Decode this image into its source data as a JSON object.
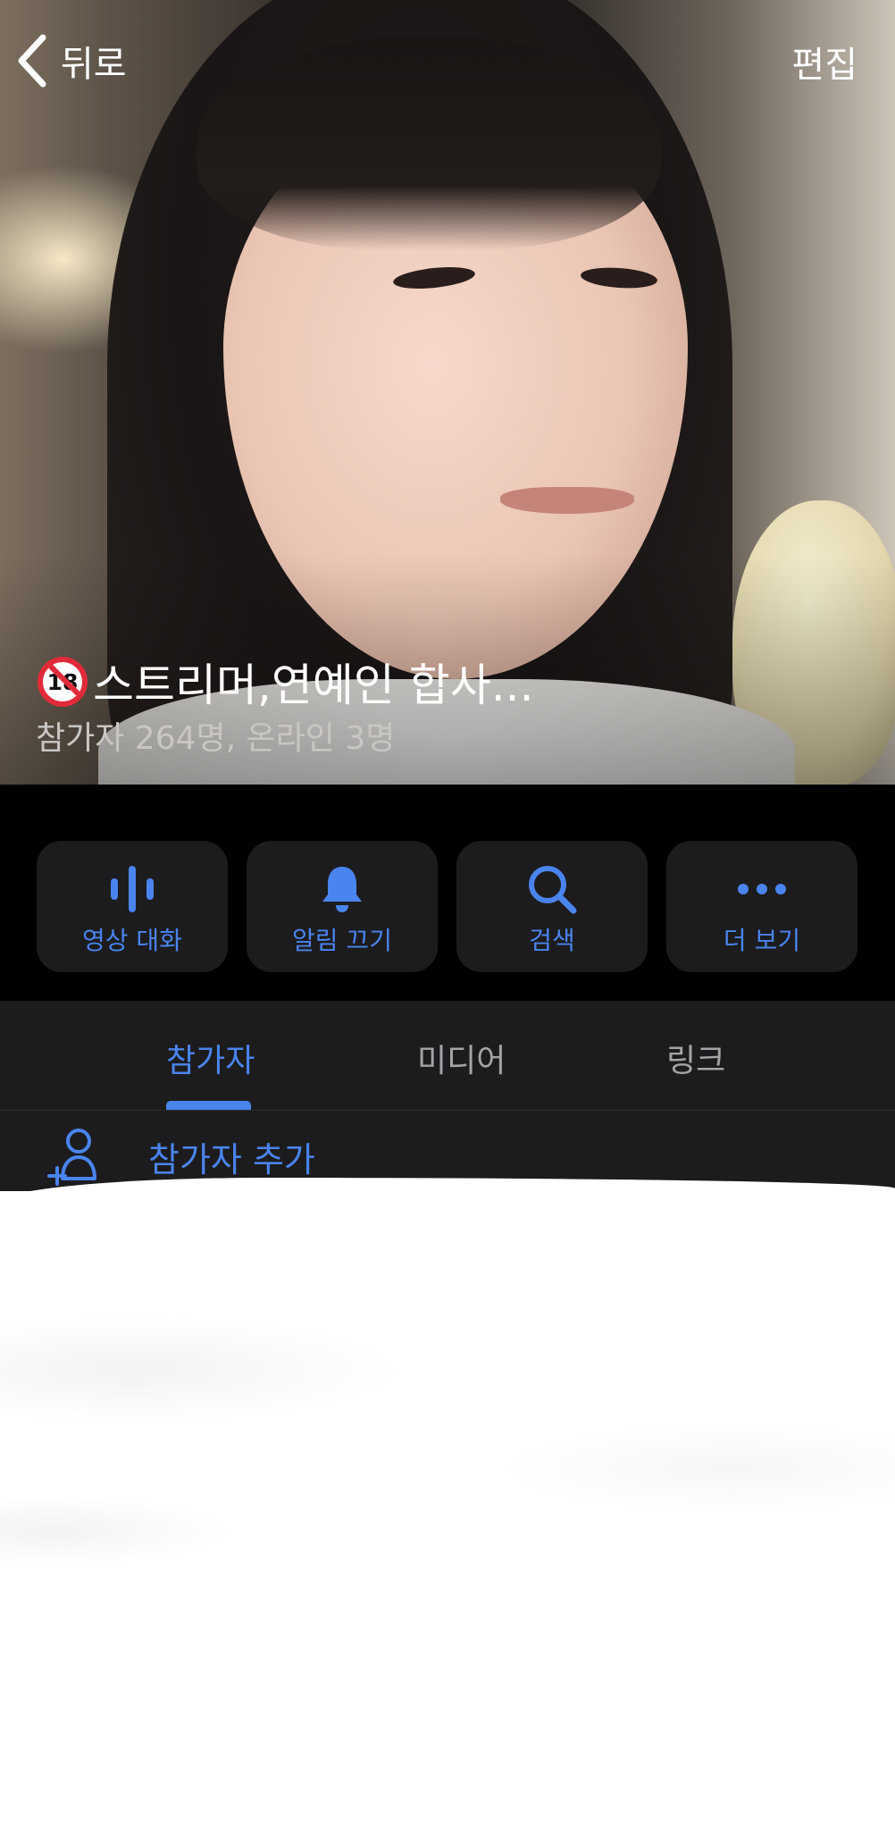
{
  "nav": {
    "back_label": "뒤로",
    "edit_label": "편집"
  },
  "group": {
    "age_badge": "18",
    "title": "스트리머,연예인 합사...",
    "subtitle": "참가자 264명, 온라인 3명"
  },
  "actions": [
    {
      "label": "영상 대화",
      "icon": "audio-waveform-icon"
    },
    {
      "label": "알림 끄기",
      "icon": "bell-icon"
    },
    {
      "label": "검색",
      "icon": "search-icon"
    },
    {
      "label": "더 보기",
      "icon": "ellipsis-icon"
    }
  ],
  "tabs": [
    {
      "label": "참가자",
      "active": true
    },
    {
      "label": "미디어",
      "active": false
    },
    {
      "label": "링크",
      "active": false
    }
  ],
  "add_participant": {
    "label": "참가자 추가",
    "icon": "add-person-icon"
  },
  "colors": {
    "accent": "#4a84ee",
    "panel": "#1c1c1e",
    "background": "#000000",
    "badge_red": "#e12b3a"
  }
}
